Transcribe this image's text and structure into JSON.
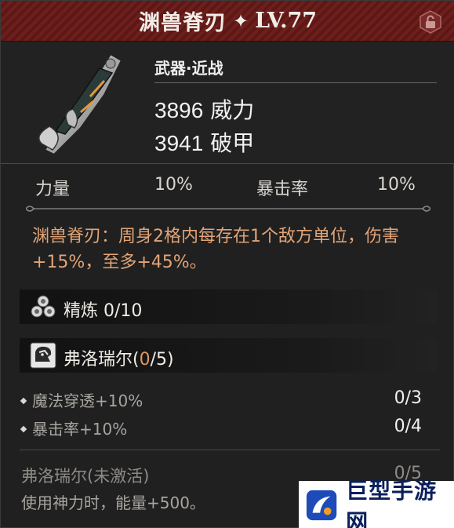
{
  "header": {
    "title": "渊兽脊刃",
    "star": "✦",
    "level": "LV.77"
  },
  "item": {
    "type": "武器·近战",
    "stats": [
      {
        "value": "3896",
        "name": "威力"
      },
      {
        "value": "3941",
        "name": "破甲"
      }
    ]
  },
  "attributes": [
    {
      "name": "力量",
      "value": "10%"
    },
    {
      "name": "暴击率",
      "value": "10%"
    }
  ],
  "description": "渊兽脊刃：周身2格内每存在1个敌方单位，伤害+15%，至多+45%。",
  "refine": {
    "label": "精炼",
    "value": "0/10"
  },
  "set": {
    "name_prefix": "弗洛瑞尔(",
    "current": "0",
    "name_suffix": "/5)",
    "bonuses": [
      {
        "label": "魔法穿透+10%",
        "progress": "0/3"
      },
      {
        "label": "暴击率+10%",
        "progress": "0/4"
      }
    ],
    "final_label": "弗洛瑞尔(未激活)",
    "final_progress": "0/5",
    "final_desc": "使用神力时，能量+500。"
  },
  "watermark": {
    "text": "巨型手游网"
  },
  "colors": {
    "header_red": "#6e1f1c",
    "desc_orange": "#e2a477",
    "set_current": "#e0965e"
  }
}
